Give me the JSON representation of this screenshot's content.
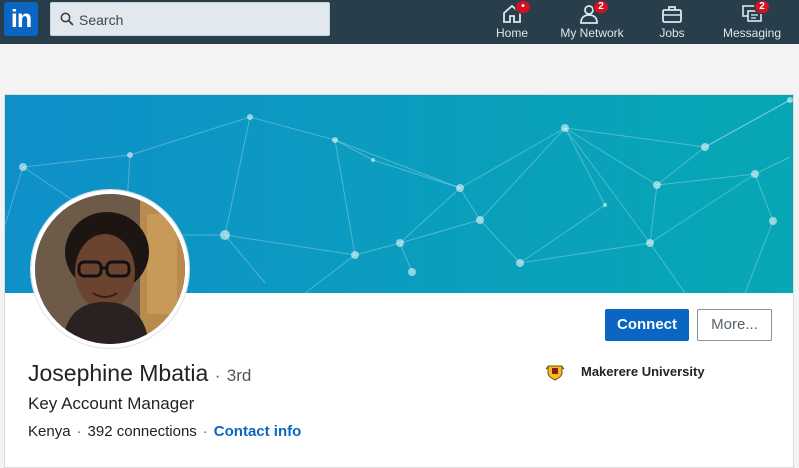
{
  "nav": {
    "logo_text": "in",
    "search_placeholder": "Search",
    "items": [
      {
        "label": "Home",
        "icon": "home-icon",
        "badge": "•"
      },
      {
        "label": "My Network",
        "icon": "network-icon",
        "badge": "2"
      },
      {
        "label": "Jobs",
        "icon": "briefcase-icon",
        "badge": ""
      },
      {
        "label": "Messaging",
        "icon": "messaging-icon",
        "badge": "2"
      }
    ]
  },
  "profile": {
    "name": "Josephine Mbatia",
    "degree_separator": "·",
    "degree": "3rd",
    "headline": "Key Account Manager",
    "location": "Kenya",
    "connections": "392 connections",
    "contact_info": "Contact info",
    "school": "Makerere University",
    "connect_label": "Connect",
    "more_label": "More..."
  },
  "colors": {
    "topbar": "#283e4a",
    "brand": "#0a66c2",
    "banner_start": "#0e8fc9",
    "banner_end": "#07a7b5",
    "badge": "#d11124"
  }
}
